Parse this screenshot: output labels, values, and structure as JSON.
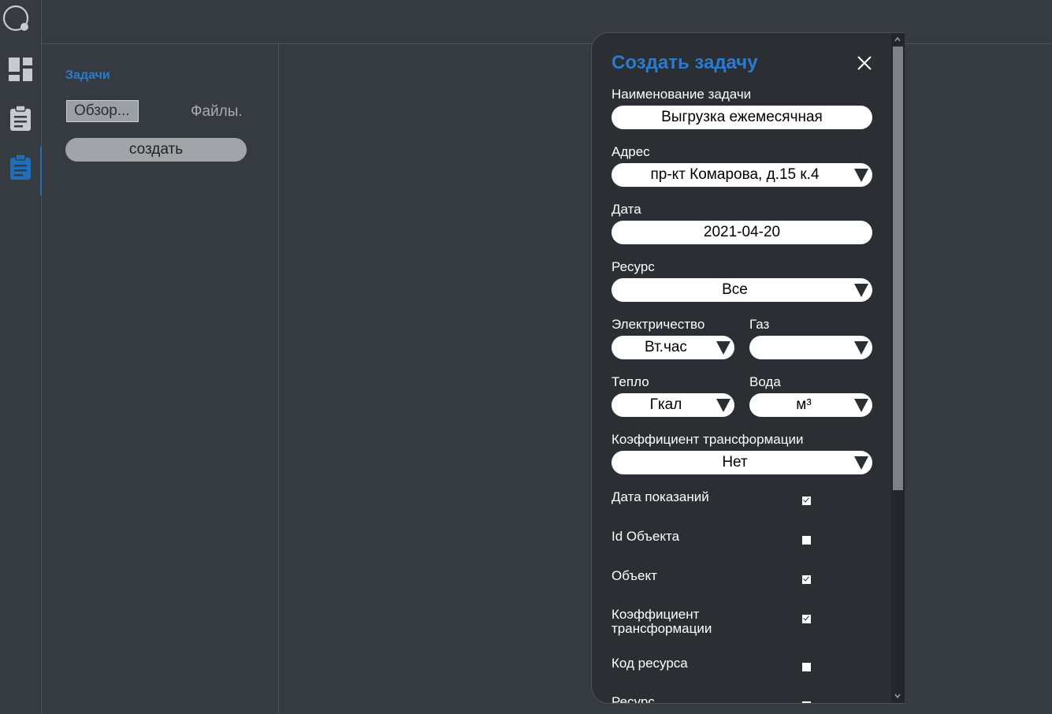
{
  "sidebar": {
    "logo_icon": "orbit-logo-icon",
    "items": [
      {
        "icon": "dashboard-icon",
        "active": false
      },
      {
        "icon": "clipboard-icon",
        "active": false
      },
      {
        "icon": "clipboard-icon",
        "active": true
      }
    ]
  },
  "panel": {
    "title": "Задачи",
    "browse_label": "Обзор...",
    "files_label": "Файлы.",
    "create_label": "создать"
  },
  "modal": {
    "title": "Создать задачу",
    "fields": {
      "name_label": "Наименование задачи",
      "name_value": "Выгрузка ежемесячная",
      "address_label": "Адрес",
      "address_value": "пр-кт Комарова, д.15 к.4",
      "date_label": "Дата",
      "date_value": "2021-04-20",
      "resource_label": "Ресурс",
      "resource_value": "Все",
      "electricity_label": "Электричество",
      "electricity_value": "Вт.час",
      "gas_label": "Газ",
      "gas_value": "",
      "heat_label": "Тепло",
      "heat_value": "Гкал",
      "water_label": "Вода",
      "water_value": "м³",
      "coef_label": "Коэффициент трансформации",
      "coef_value": "Нет"
    },
    "checkboxes": [
      {
        "label": "Дата показаний",
        "checked": true
      },
      {
        "label": "Id Объекта",
        "checked": false
      },
      {
        "label": "Объект",
        "checked": true
      },
      {
        "label": "Коэффициент трансформации",
        "checked": true
      },
      {
        "label": "Код ресурса",
        "checked": false
      },
      {
        "label": "Ресурс",
        "checked": false
      }
    ]
  },
  "colors": {
    "background": "#353b40",
    "accent": "#2a7bd0",
    "modal_bg": "#2b2f33"
  }
}
